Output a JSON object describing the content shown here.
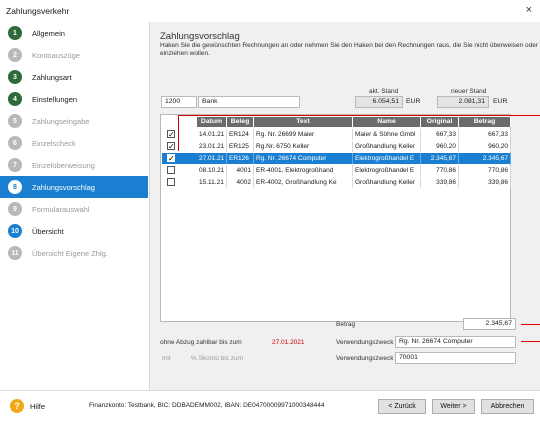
{
  "window": {
    "title": "Zahlungsverkehr",
    "close_icon": "×"
  },
  "sidebar": {
    "items": [
      {
        "num": "1",
        "label": "Allgemein",
        "state": "done"
      },
      {
        "num": "2",
        "label": "Kontoauszüge",
        "state": "dim"
      },
      {
        "num": "3",
        "label": "Zahlungsart",
        "state": "done"
      },
      {
        "num": "4",
        "label": "Einstellungen",
        "state": "done"
      },
      {
        "num": "5",
        "label": "Zahlungseingabe",
        "state": "dim"
      },
      {
        "num": "6",
        "label": "Einzelscheck",
        "state": "dim"
      },
      {
        "num": "7",
        "label": "Einzelüberweisung",
        "state": "dim"
      },
      {
        "num": "8",
        "label": "Zahlungsvorschlag",
        "state": "active"
      },
      {
        "num": "9",
        "label": "Formularauswahl",
        "state": "dim"
      },
      {
        "num": "10",
        "label": "Übersicht",
        "state": "blue"
      },
      {
        "num": "11",
        "label": "Übersicht Eigene Zhlg.",
        "state": "dim"
      }
    ]
  },
  "main": {
    "title": "Zahlungsvorschlag",
    "description": "Haken Sie die gewünschten Rechnungen an oder nehmen Sie den Haken bei den Rechnungen raus, die Sie nicht überweisen oder einziehen wollen.",
    "account_number": "1200",
    "account_name": "Bank",
    "current_balance_label": "akt. Stand",
    "current_balance": "6.054,51",
    "new_balance_label": "neuer Stand",
    "new_balance": "2.081,31",
    "currency": "EUR"
  },
  "table": {
    "columns": [
      "Datum",
      "Beleg",
      "Text",
      "Name",
      "Original",
      "Betrag"
    ],
    "rows": [
      {
        "checked": true,
        "date": "14.01.21",
        "beleg": "ER124",
        "text": "Rg. Nr. 26699 Maier",
        "name": "Maier & Söhne Gmbl",
        "original": "667,33",
        "betrag": "667,33",
        "selected": false
      },
      {
        "checked": true,
        "date": "23.01.21",
        "beleg": "ER125",
        "text": "Rg.Nr. 6750 Keller",
        "name": "Großhandlung Keller",
        "original": "960,20",
        "betrag": "960,20",
        "selected": false
      },
      {
        "checked": true,
        "date": "27.01.21",
        "beleg": "ER126",
        "text": "Rg. Nr. 26674 Computer",
        "name": "Elektrogroßhandel E",
        "original": "2.345,67",
        "betrag": "2.345,67",
        "selected": true
      },
      {
        "checked": false,
        "date": "08.10.21",
        "beleg": "4001",
        "text": "ER-4001, Elektrogroßhand",
        "name": "Elektrogroßhandel E",
        "original": "770,86",
        "betrag": "770,86",
        "selected": false
      },
      {
        "checked": false,
        "date": "15.11.21",
        "beleg": "4002",
        "text": "ER-4002, Großhandlung Ke",
        "name": "Großhandlung Keller",
        "original": "339,86",
        "betrag": "339,86",
        "selected": false
      }
    ]
  },
  "details": {
    "betrag_label": "Betrag",
    "betrag_value": "2.345,67",
    "vz1_label": "Verwendungszweck 1",
    "vz1_value": "Rg. Nr. 26674 Computer",
    "vz2_label": "Verwendungszweck 2",
    "vz2_value": "70001",
    "ohne_abzug_label": "ohne Abzug zahlbar bis zum",
    "ohne_abzug_date": "27.01.2021",
    "mit_label": "mit",
    "skonto_label": "% Skonto bis zum"
  },
  "footer": {
    "help_icon": "?",
    "help_label": "Hilfe",
    "info": "Finanzkonto: Testbank, BIC: DDBADEMM002, IBAN: DE04700009971000348444",
    "back_label": "< Zurück",
    "next_label": "Weiter >",
    "cancel_label": "Abbrechen"
  },
  "colors": {
    "accent": "#1a7fd1",
    "done": "#2f6b3a",
    "warning": "#d00000",
    "help": "#f0a818"
  }
}
